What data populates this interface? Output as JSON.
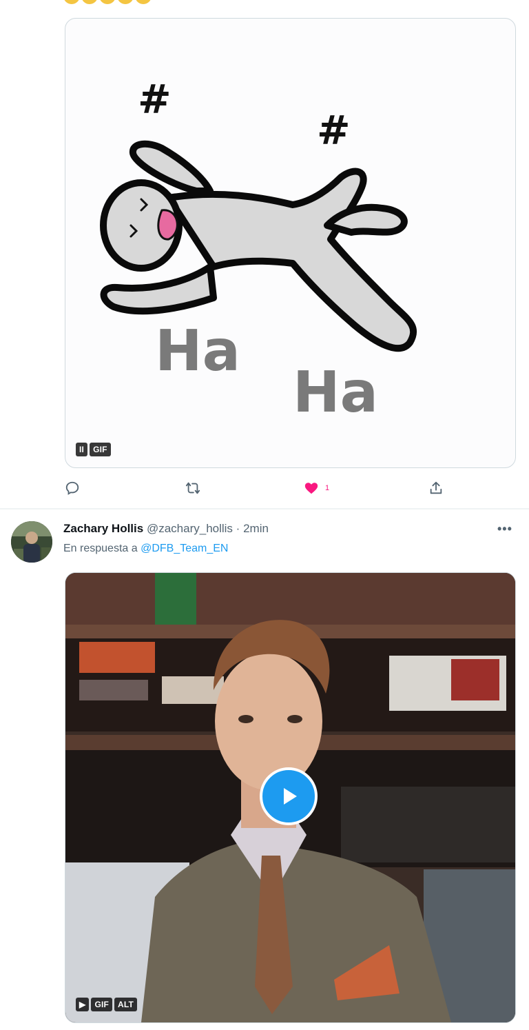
{
  "tweet1": {
    "media": {
      "type": "GIF",
      "gif_label": "GIF",
      "pause_symbol": "II",
      "drawing_text_1": "Ha",
      "drawing_text_2": "Ha",
      "drawing_symbol": "#"
    },
    "actions": {
      "reply_icon": "reply-icon",
      "retweet_icon": "retweet-icon",
      "like_icon": "heart-icon",
      "like_count": "1",
      "share_icon": "share-icon"
    }
  },
  "tweet2": {
    "author": {
      "name": "Zachary Hollis",
      "handle": "@zachary_hollis",
      "separator": "·",
      "time": "2min"
    },
    "reply_to_prefix": "En respuesta a",
    "reply_to_handle": "@DFB_Team_EN",
    "more_icon": "•••",
    "media": {
      "gif_label": "GIF",
      "alt_label": "ALT",
      "play_symbol": "▶"
    }
  },
  "colors": {
    "accent": "#1d9bf0",
    "like": "#f91880",
    "muted": "#536471",
    "border": "#cfd9de"
  }
}
